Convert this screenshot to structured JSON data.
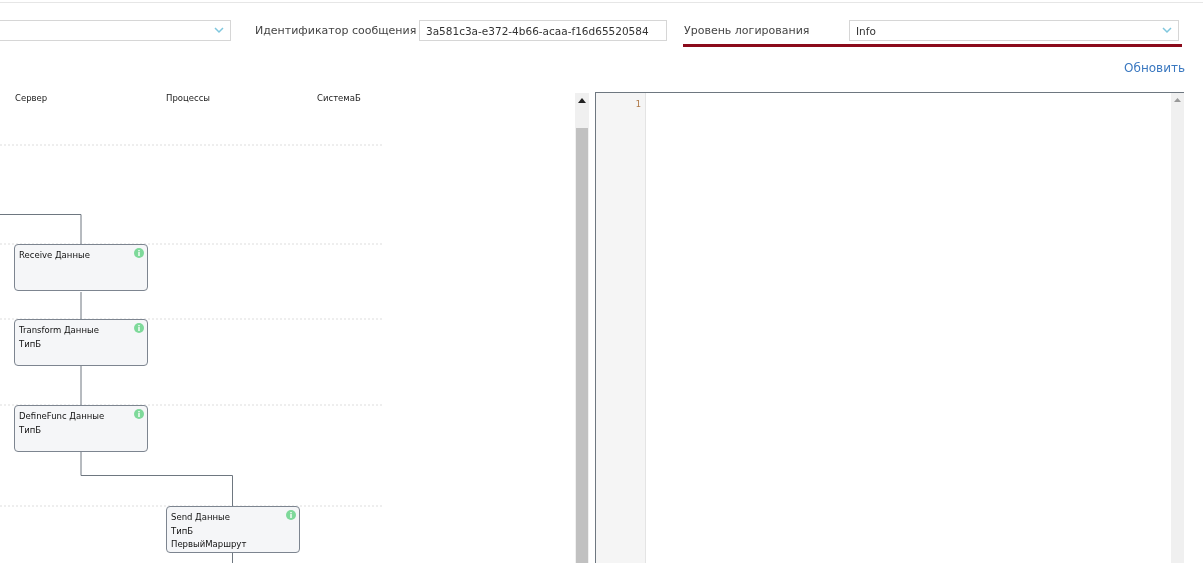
{
  "filters": [
    {
      "kind": "select",
      "focused": false
    },
    {
      "kind": "text",
      "label": "Идентификатор сообщения",
      "value": "3a581c3a-e372-4b66-acaa-f16d65520584",
      "focused": false
    },
    {
      "kind": "select",
      "label": "Уровень логирования",
      "value": "Info",
      "focused": true
    }
  ],
  "refresh_link": "Обновить",
  "diagram": {
    "lanes": [
      "Сервер",
      "Процессы",
      "СистемаБ"
    ],
    "nodes": [
      {
        "lines": [
          "Receive Данные"
        ]
      },
      {
        "lines": [
          "Transform Данные",
          "ТипБ"
        ]
      },
      {
        "lines": [
          "DefineFunc Данные",
          "ТипБ"
        ]
      },
      {
        "lines": [
          "Send Данные",
          "ТипБ",
          "ПервыйМаршрут"
        ]
      }
    ]
  },
  "editor": {
    "line_numbers": [
      "1"
    ]
  }
}
